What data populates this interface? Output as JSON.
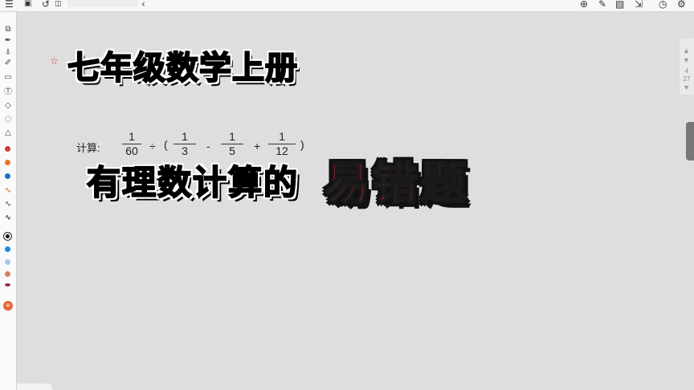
{
  "toolbar": {
    "left_icons": [
      "menu-icon",
      "save-icon",
      "undo-icon",
      "redo-icon"
    ],
    "input_placeholder": "",
    "right_icons": [
      "globe-icon",
      "edit-icon",
      "image-icon",
      "export-icon",
      "history-icon",
      "settings-icon"
    ]
  },
  "tools": {
    "items": [
      "select-icon",
      "pen-icon",
      "marker-icon",
      "pencil-icon",
      "eraser-icon",
      "text-icon",
      "shape-icon",
      "lasso-icon",
      "ruler-icon"
    ],
    "stroke_styles": [
      "wave-thin-icon",
      "wave-medium-icon",
      "wave-thick-icon"
    ],
    "colors_top": [
      "#d23a3a",
      "#e8762c",
      "#1a73c8"
    ],
    "colors_bottom": [
      "#111111",
      "#1f8ae0",
      "#a9c9ee",
      "#d9825a",
      "#9a2f4a"
    ]
  },
  "canvas": {
    "star": "☆",
    "title": "七年级数学上册",
    "ghost_text": "有理数计算",
    "calc_label": "计算:",
    "expression": {
      "f1": {
        "num": "1",
        "den": "60"
      },
      "div": "÷",
      "open": "(",
      "f2": {
        "num": "1",
        "den": "3"
      },
      "minus": "-",
      "f3": {
        "num": "1",
        "den": "5"
      },
      "plus": "+",
      "f4": {
        "num": "1",
        "den": "12"
      },
      "close": ")"
    },
    "subtitle": "有理数计算的",
    "highlight": "易错题"
  },
  "pager": {
    "current": "4",
    "total": "27"
  }
}
